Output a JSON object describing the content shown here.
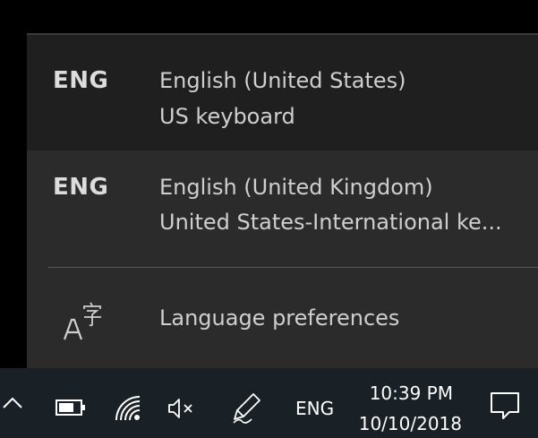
{
  "flyout": {
    "languages": [
      {
        "code": "ENG",
        "name": "English (United States)",
        "layout": "US keyboard"
      },
      {
        "code": "ENG",
        "name": "English (United Kingdom)",
        "layout": "United States-International ke..."
      }
    ],
    "preferences_label": "Language preferences",
    "preferences_icon": "language-icon"
  },
  "taskbar": {
    "icons": [
      "chevron-up-icon",
      "battery-icon",
      "wifi-icon",
      "volume-muted-icon",
      "pen-icon",
      "notification-icon"
    ],
    "language_indicator": "ENG",
    "time": "10:39 PM",
    "date": "10/10/2018"
  },
  "colors": {
    "flyout_background": "#2b2b2b",
    "selected_background": "#1f1f1f",
    "taskbar_background": "#1a2126",
    "text": "#dcdcdc"
  }
}
